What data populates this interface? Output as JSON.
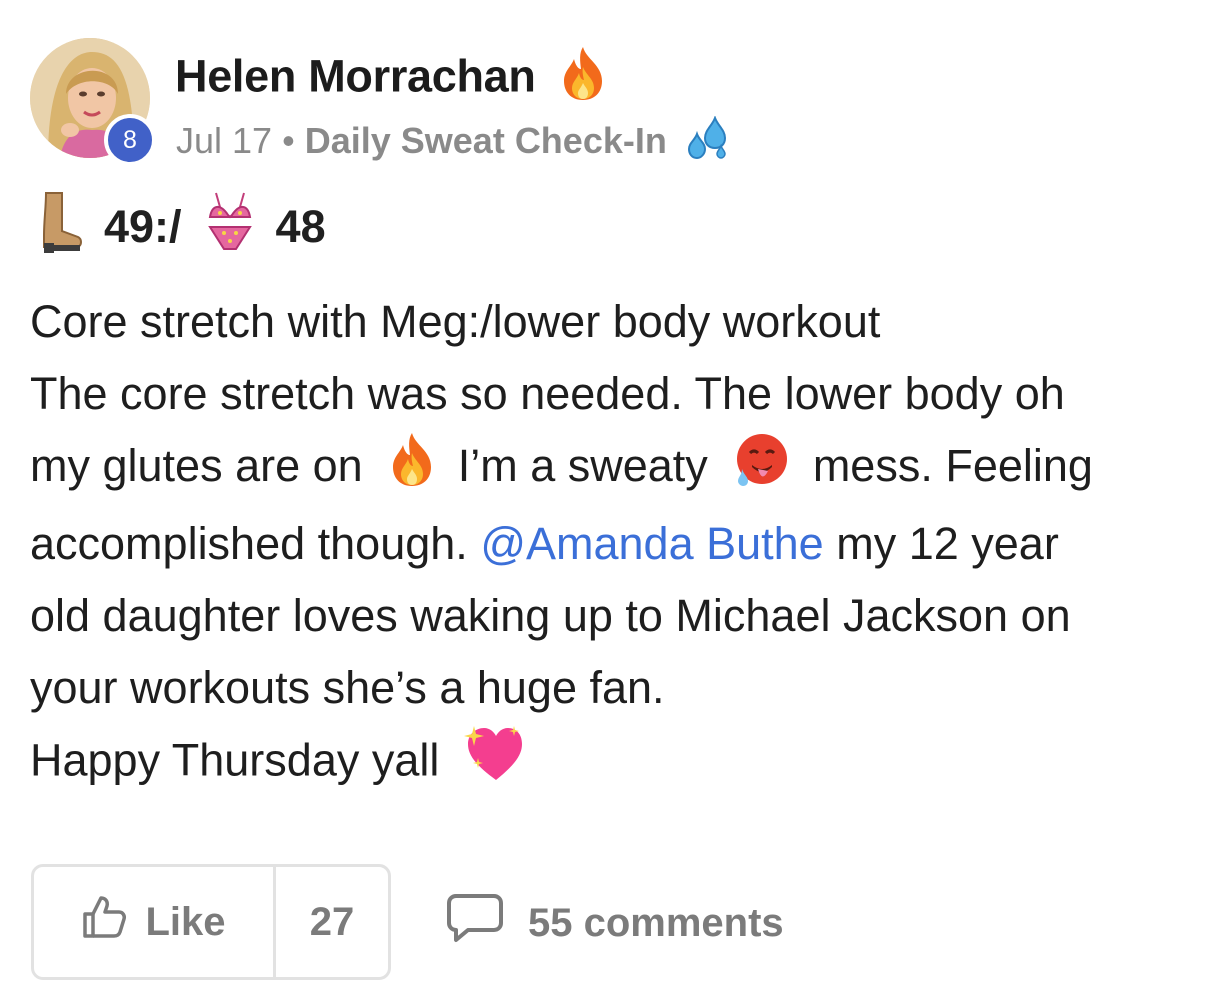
{
  "post": {
    "author": {
      "name": "Helen Morrachan",
      "name_emoji": "fire-emoji",
      "level": "8"
    },
    "meta": {
      "date": "Jul 17",
      "separator": "•",
      "category": "Daily Sweat Check-In",
      "category_emoji": "sweat-droplets-emoji"
    },
    "stats": {
      "boot_emoji": "boot-emoji",
      "first_value": "49:/",
      "bikini_emoji": "bikini-emoji",
      "second_value": "48"
    },
    "body": {
      "line1": "Core stretch with Meg:/lower body workout",
      "line2": "The core stretch was so needed. The lower body oh",
      "line3_a": "my glutes are on",
      "line3_b": "I’m a sweaty",
      "line3_c": "mess. Feeling",
      "line4_a": "accomplished though.",
      "mention": "@Amanda Buthe",
      "line4_b": "my 12 year",
      "line5": "old daughter loves waking up to Michael Jackson on",
      "line6": "your workouts she’s a huge fan.",
      "line7": "Happy Thursday yall"
    },
    "actions": {
      "like_label": "Like",
      "like_count": "27",
      "comments_label": "55 comments"
    }
  },
  "colors": {
    "mention": "#3b6fd8",
    "level_badge": "#4161c8",
    "muted": "#7b7b7b"
  }
}
